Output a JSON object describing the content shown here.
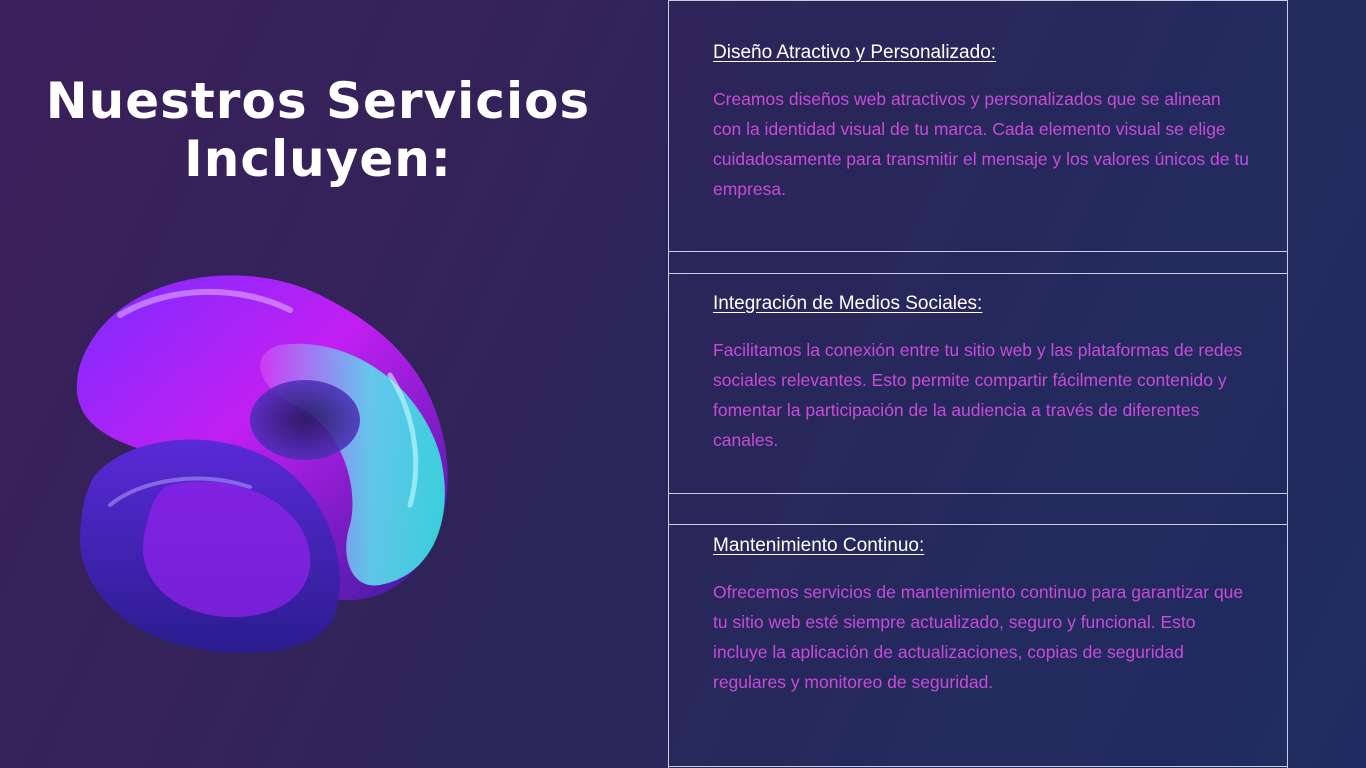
{
  "slide": {
    "title": "Nuestros Servicios Incluyen:",
    "services": [
      {
        "heading": "Diseño Atractivo y Personalizado:",
        "body": "Creamos diseños web atractivos y personalizados que se alinean con la identidad visual de tu marca. Cada elemento visual se elige cuidadosamente para transmitir el mensaje y los valores únicos de tu empresa."
      },
      {
        "heading": "Integración de Medios Sociales:",
        "body": "Facilitamos la conexión entre tu sitio web y las plataformas de redes sociales relevantes. Esto permite compartir fácilmente contenido y fomentar la participación de la audiencia a través de diferentes canales."
      },
      {
        "heading": "Mantenimiento Continuo:",
        "body": "Ofrecemos servicios de mantenimiento continuo para garantizar que tu sitio web esté siempre actualizado, seguro y funcional. Esto incluye la aplicación de actualizaciones, copias de seguridad regulares y monitoreo de seguridad."
      }
    ]
  },
  "colors": {
    "title": "#ffffff",
    "heading": "#ffffff",
    "body_text": "#c84bd9",
    "divider": "#c9cde6",
    "accent_purple": "#a21cf0",
    "accent_cyan": "#3fe0e8"
  }
}
